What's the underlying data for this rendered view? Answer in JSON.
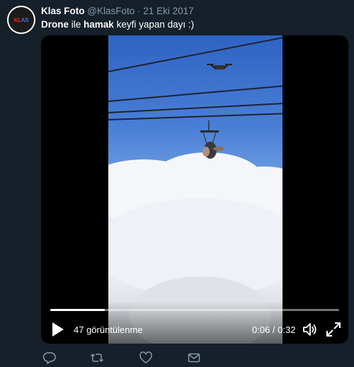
{
  "tweet": {
    "author_name": "Klas Foto",
    "author_handle": "@KlasFoto",
    "separator": "·",
    "date": "21 Eki 2017",
    "text_parts": [
      "Drone",
      " ile ",
      "hamak",
      " keyfi yapan dayı :)"
    ],
    "avatar_text": [
      "KLAS",
      "FOTO"
    ]
  },
  "video": {
    "view_count": "47 görüntülenme",
    "elapsed": "0:06",
    "duration": "0:32",
    "time_display": "0:06 / 0:32",
    "progress_fraction": 0.1875
  },
  "actions": {
    "icons": [
      "reply-icon",
      "retweet-icon",
      "like-icon",
      "message-icon"
    ]
  },
  "colors": {
    "background": "#15202b",
    "secondary_text": "#8899a6",
    "icon": "#8899a6"
  }
}
